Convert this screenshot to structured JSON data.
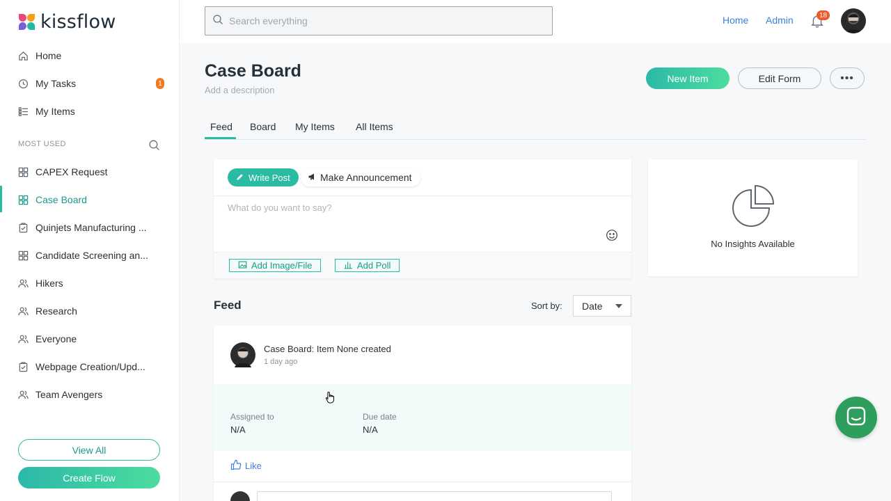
{
  "brand": {
    "name": "kissflow"
  },
  "sidebar": {
    "top_items": [
      {
        "label": "Home",
        "icon": "home-icon"
      },
      {
        "label": "My Tasks",
        "icon": "clock-icon",
        "badge": "1"
      },
      {
        "label": "My Items",
        "icon": "list-icon"
      }
    ],
    "section_label": "MOST USED",
    "used_items": [
      {
        "label": "CAPEX Request",
        "icon": "grid-icon"
      },
      {
        "label": "Case Board",
        "icon": "grid-icon",
        "active": true
      },
      {
        "label": "Quinjets Manufacturing ...",
        "icon": "clipboard-icon"
      },
      {
        "label": "Candidate Screening an...",
        "icon": "grid-icon"
      },
      {
        "label": "Hikers",
        "icon": "people-icon"
      },
      {
        "label": "Research",
        "icon": "people-icon"
      },
      {
        "label": "Everyone",
        "icon": "people-icon"
      },
      {
        "label": "Webpage Creation/Upd...",
        "icon": "clipboard-icon"
      },
      {
        "label": "Team Avengers",
        "icon": "people-icon"
      }
    ],
    "view_all_label": "View All",
    "create_flow_label": "Create Flow"
  },
  "header": {
    "search_placeholder": "Search everything",
    "links": [
      "Home",
      "Admin"
    ],
    "notification_count": "18"
  },
  "page": {
    "title": "Case Board",
    "description_placeholder": "Add a description",
    "new_item_label": "New Item",
    "edit_form_label": "Edit Form",
    "more_label": "•••",
    "tabs": [
      "Feed",
      "Board",
      "My Items",
      "All Items"
    ],
    "active_tab": "Feed"
  },
  "compose": {
    "write_post_label": "Write Post",
    "announce_label": "Make Announcement",
    "input_placeholder": "What do you want to say?",
    "add_file_label": "Add Image/File",
    "add_poll_label": "Add Poll"
  },
  "insights": {
    "empty_text": "No Insights Available"
  },
  "feed": {
    "heading": "Feed",
    "sort_label": "Sort by:",
    "sort_value": "Date",
    "items": [
      {
        "title": "Case Board: Item None created",
        "time": "1 day ago",
        "assigned_label": "Assigned to",
        "assigned_value": "N/A",
        "due_label": "Due date",
        "due_value": "N/A",
        "like_label": "Like"
      }
    ]
  },
  "colors": {
    "accent": "#2bbba3",
    "link": "#3b7fd9",
    "badge": "#f07a22",
    "chat": "#2e9e5d"
  }
}
